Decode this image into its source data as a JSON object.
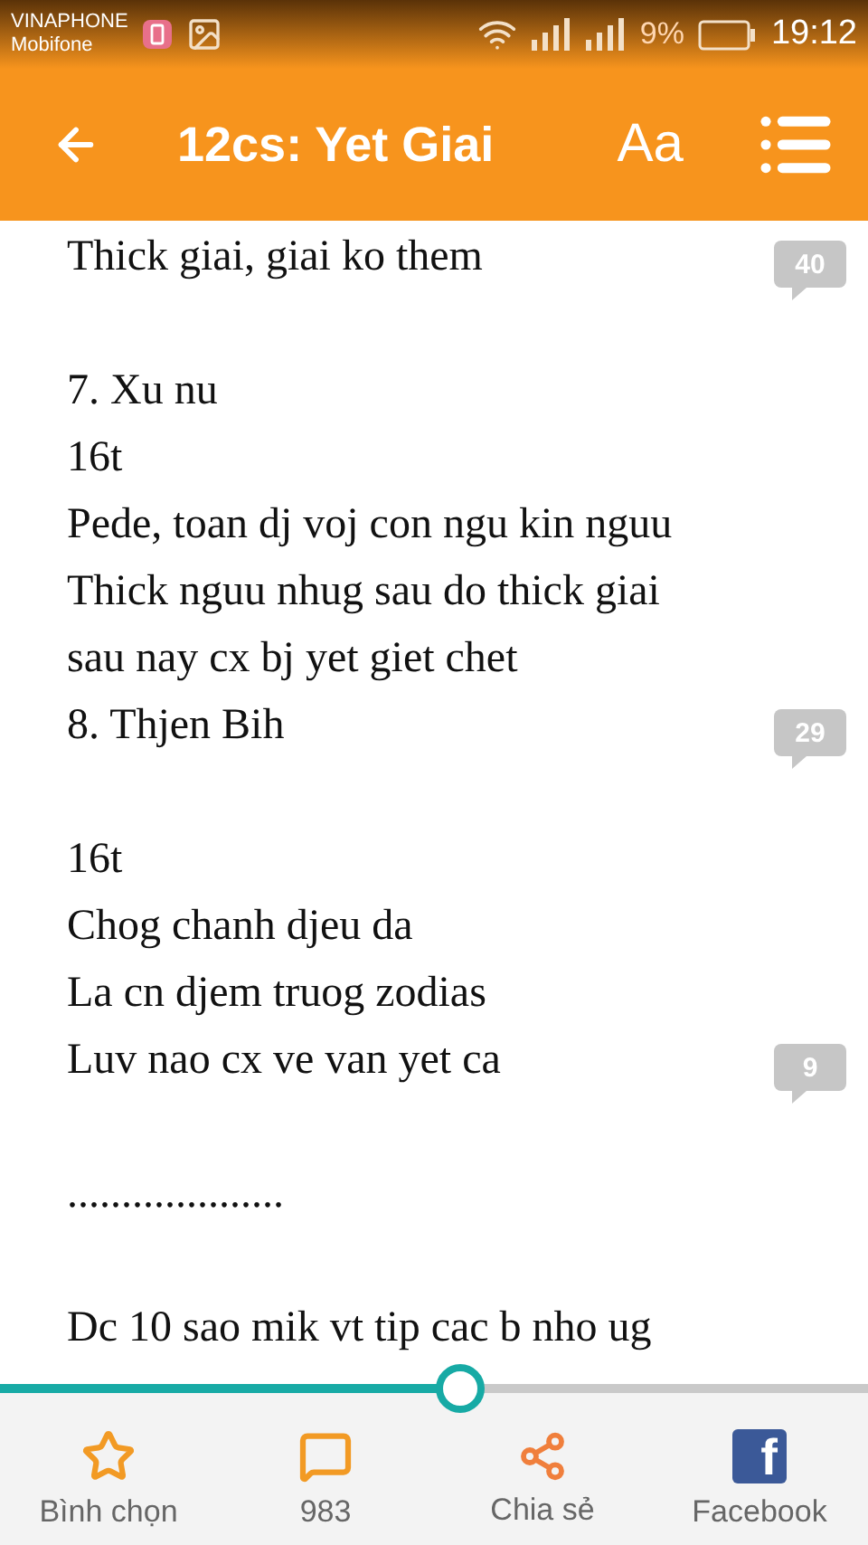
{
  "status_bar": {
    "carrier_1": "VINAPHONE",
    "carrier_2": "Mobifone",
    "battery_text": "9%",
    "time": "19:12"
  },
  "header": {
    "title": "12cs: Yet Giai",
    "font_button": "Aa"
  },
  "lines": [
    {
      "kind": "text",
      "text": "Thick giai, giai ko them",
      "comments": "40"
    },
    {
      "kind": "blank"
    },
    {
      "kind": "text",
      "text": "7. Xu nu"
    },
    {
      "kind": "text",
      "text": "16t"
    },
    {
      "kind": "text",
      "text": "Pede, toan dj voj con ngu kin nguu"
    },
    {
      "kind": "text",
      "text": "Thick nguu nhug sau do thick giai"
    },
    {
      "kind": "text",
      "text": "sau nay cx bj yet giet chet"
    },
    {
      "kind": "text",
      "text": "8. Thjen Bih",
      "comments": "29"
    },
    {
      "kind": "blank"
    },
    {
      "kind": "text",
      "text": "16t"
    },
    {
      "kind": "text",
      "text": "Chog chanh djeu da"
    },
    {
      "kind": "text",
      "text": "La cn djem truog zodias"
    },
    {
      "kind": "text",
      "text": "Luv nao cx ve van yet ca",
      "comments": "9"
    },
    {
      "kind": "blank"
    },
    {
      "kind": "text",
      "text": "...................."
    },
    {
      "kind": "blank"
    },
    {
      "kind": "text",
      "text": "Dc 10 sao mik vt tip cac b nho ug"
    }
  ],
  "progress": {
    "level": 0.53
  },
  "bottom_bar": [
    {
      "kind": "vote",
      "label": "Bình chọn"
    },
    {
      "kind": "comments",
      "label": "983"
    },
    {
      "kind": "share",
      "label": "Chia sẻ"
    },
    {
      "kind": "facebook",
      "label": "Facebook",
      "logo": "f"
    }
  ]
}
